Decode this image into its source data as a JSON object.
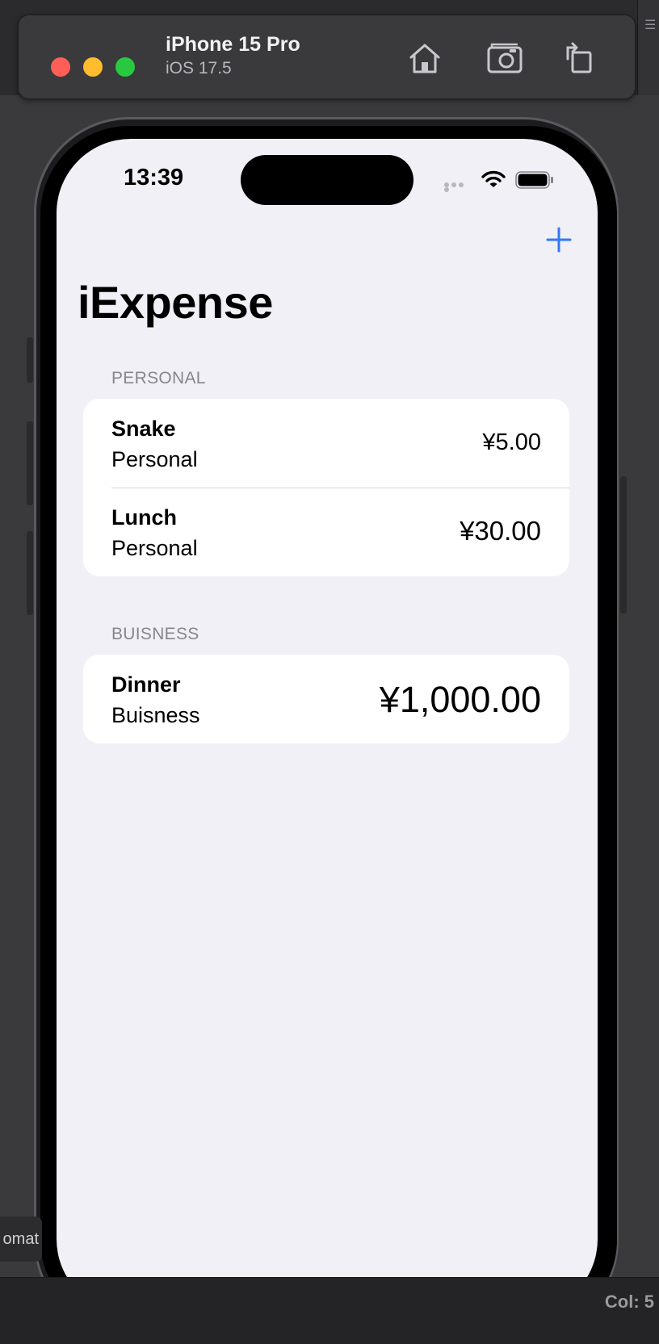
{
  "simulator": {
    "device_name": "iPhone 15 Pro",
    "os_version": "iOS 17.5",
    "icons": [
      "home-icon",
      "screenshot-icon",
      "rotate-icon"
    ]
  },
  "background": {
    "left_stub_text": "omat",
    "col_indicator": "Col: 5"
  },
  "status_bar": {
    "time": "13:39"
  },
  "app": {
    "title": "iExpense",
    "accent_color": "#3478f6",
    "sections": [
      {
        "header": "PERSONAL",
        "items": [
          {
            "name": "Snake",
            "type": "Personal",
            "amount": "¥5.00"
          },
          {
            "name": "Lunch",
            "type": "Personal",
            "amount": "¥30.00"
          }
        ]
      },
      {
        "header": "BUISNESS",
        "items": [
          {
            "name": "Dinner",
            "type": "Buisness",
            "amount": "¥1,000.00"
          }
        ]
      }
    ]
  }
}
